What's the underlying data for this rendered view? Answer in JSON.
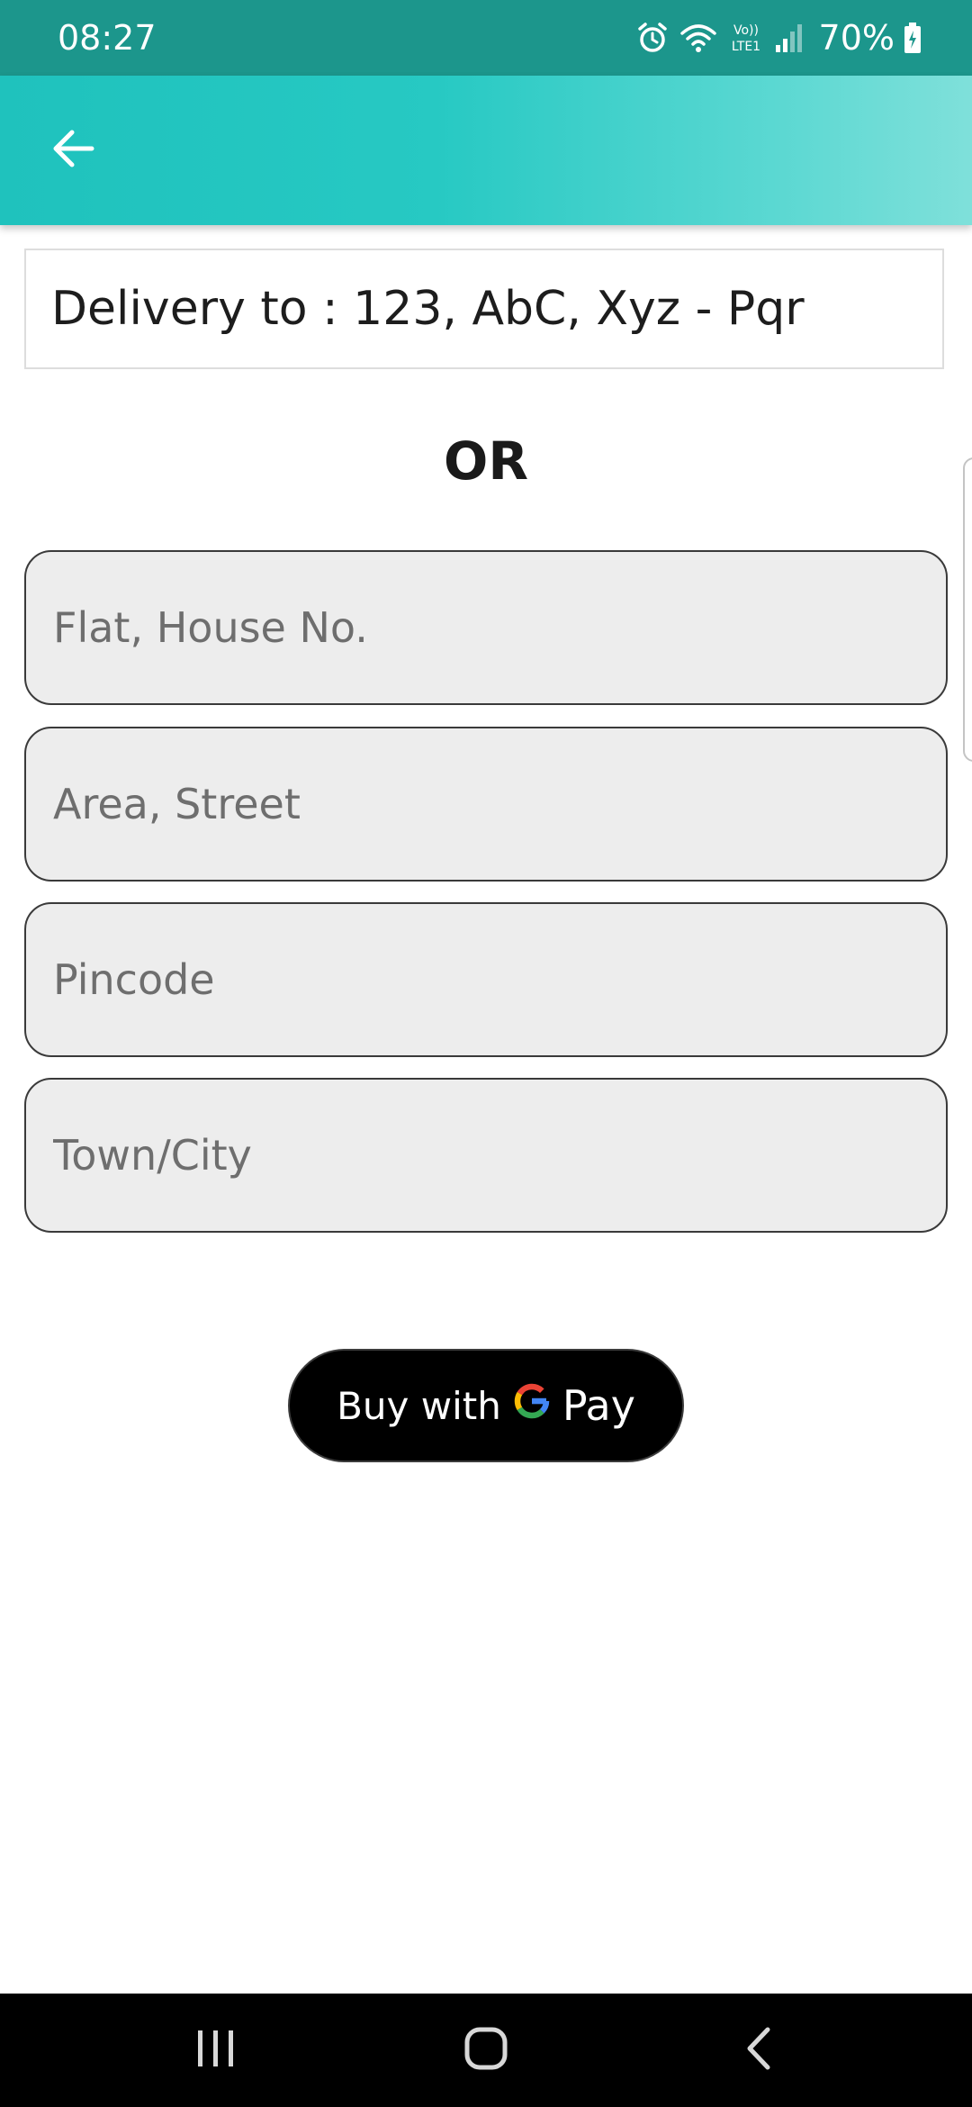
{
  "status_bar": {
    "time": "08:27",
    "battery": "70%",
    "network_label": "Vo)) LTE1",
    "icons": [
      "alarm-icon",
      "wifi-icon",
      "volte-icon",
      "signal-icon",
      "battery-icon"
    ]
  },
  "app_bar": {
    "back_icon": "arrow-left-icon",
    "color": "#1fc2bd"
  },
  "delivery": {
    "text": "Delivery to : 123, AbC, Xyz - Pqr"
  },
  "separator": {
    "label": "OR"
  },
  "form": {
    "flat": {
      "value": "",
      "placeholder": "Flat, House No."
    },
    "area": {
      "value": "",
      "placeholder": "Area, Street"
    },
    "pincode": {
      "value": "",
      "placeholder": "Pincode"
    },
    "city": {
      "value": "",
      "placeholder": "Town/City"
    }
  },
  "payment": {
    "label": "Buy with",
    "brand_text": "Pay",
    "icon": "google-g-icon",
    "color": "#000000"
  },
  "nav_bar": {
    "icons": [
      "recents-icon",
      "home-icon",
      "back-icon"
    ]
  }
}
